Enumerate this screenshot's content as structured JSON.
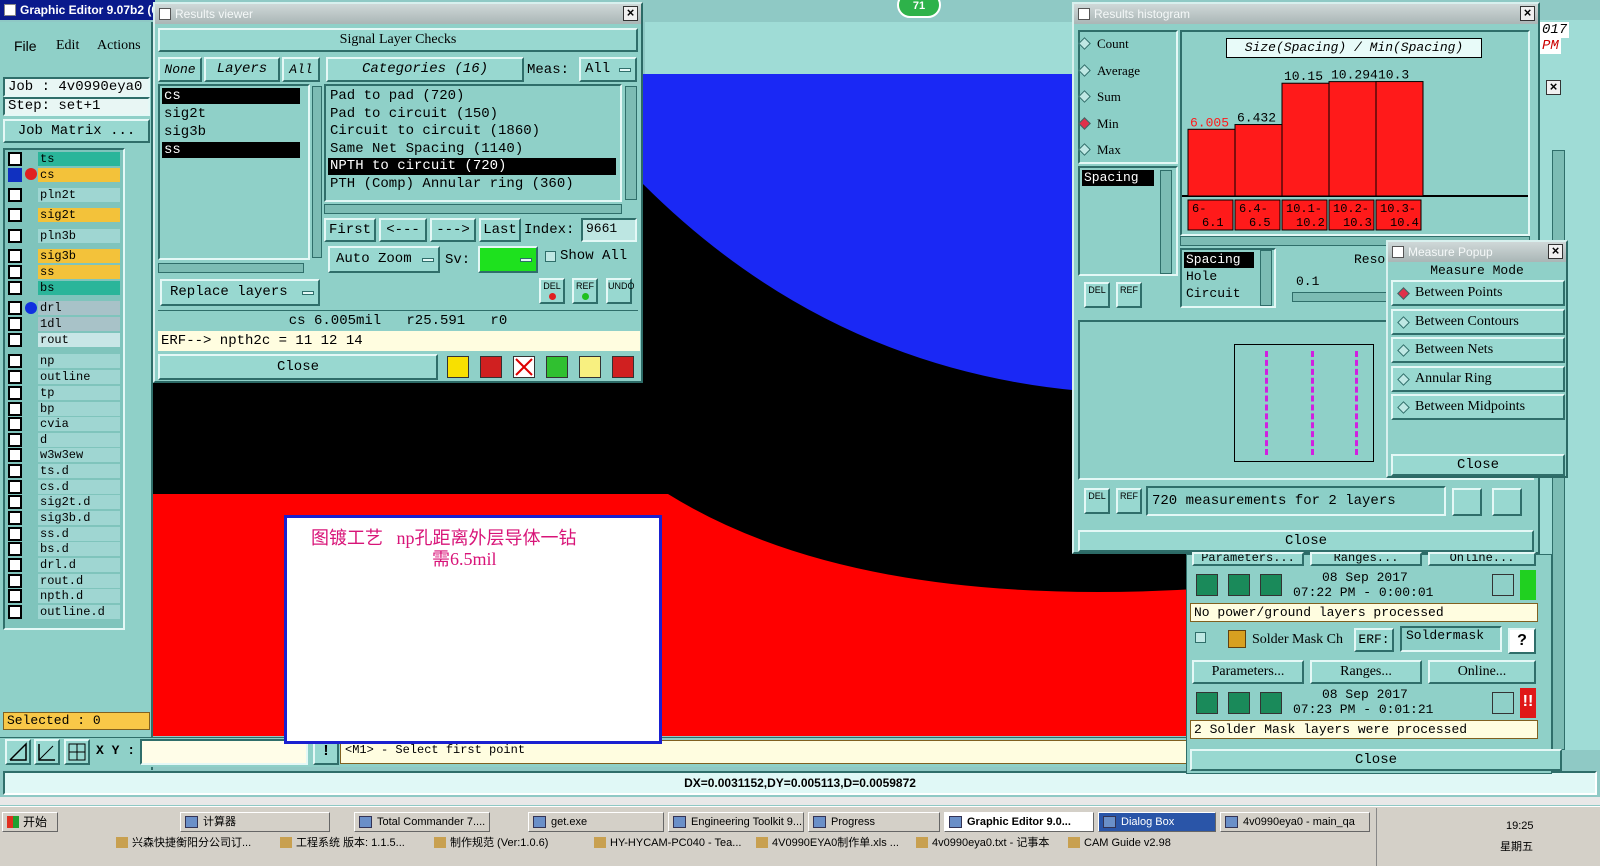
{
  "main": {
    "title": "Graphic Editor 9.07b2 (0",
    "menu": [
      "File",
      "Edit",
      "Actions"
    ],
    "job": "Job : 4v0990eya0",
    "step": "Step: set+1",
    "job_matrix": "Job Matrix ...",
    "layers": [
      {
        "name": "ts",
        "color": "#2ab59a"
      },
      {
        "name": "cs",
        "color": "#f3c23a"
      },
      {
        "name": "pln2t",
        "color": "#9fd6d2"
      },
      {
        "name": "sig2t",
        "color": "#f3c23a"
      },
      {
        "name": "pln3b",
        "color": "#9fd6d2"
      },
      {
        "name": "sig3b",
        "color": "#f3c23a"
      },
      {
        "name": "ss",
        "color": "#f3c23a"
      },
      {
        "name": "bs",
        "color": "#2ab59a"
      },
      {
        "name": "drl",
        "color": "#a8c2c8"
      },
      {
        "name": "1dl",
        "color": "#a8c2c8"
      },
      {
        "name": "rout",
        "color": "#c8e6e6"
      },
      {
        "name": "np",
        "color": "#9fd6d2"
      },
      {
        "name": "outline",
        "color": "#9fd6d2"
      },
      {
        "name": "tp",
        "color": "#9fd6d2"
      },
      {
        "name": "bp",
        "color": "#9fd6d2"
      },
      {
        "name": "cvia",
        "color": "#9fd6d2"
      },
      {
        "name": "d",
        "color": "#9fd6d2"
      },
      {
        "name": "w3w3ew",
        "color": "#9fd6d2"
      },
      {
        "name": "ts.d",
        "color": "#9fd6d2"
      },
      {
        "name": "cs.d",
        "color": "#9fd6d2"
      },
      {
        "name": "sig2t.d",
        "color": "#9fd6d2"
      },
      {
        "name": "sig3b.d",
        "color": "#9fd6d2"
      },
      {
        "name": "ss.d",
        "color": "#9fd6d2"
      },
      {
        "name": "bs.d",
        "color": "#9fd6d2"
      },
      {
        "name": "drl.d",
        "color": "#9fd6d2"
      },
      {
        "name": "rout.d",
        "color": "#9fd6d2"
      },
      {
        "name": "npth.d",
        "color": "#9fd6d2"
      },
      {
        "name": "outline.d",
        "color": "#9fd6d2"
      }
    ],
    "selected": "Selected : 0",
    "xy_label": "X Y :",
    "prompt": "<M1> - Select first point",
    "status": "DX=0.0031152,DY=0.005113,D=0.0059872",
    "badge": "71",
    "note_line1": "图镀工艺   np孔距离外层导体一钻",
    "note_line2": "需6.5mil"
  },
  "results_viewer": {
    "title": "Results viewer",
    "header": "Signal Layer Checks",
    "none": "None",
    "layers": "Layers",
    "all": "All",
    "categories": "Categories (16)",
    "meas_label": "Meas:",
    "meas_value": "All",
    "layer_list": [
      "cs",
      "sig2t",
      "sig3b",
      "ss"
    ],
    "category_list": [
      "Pad to pad (720)",
      "Pad to circuit (150)",
      "Circuit to circuit (1860)",
      "Same Net Spacing (1140)",
      "NPTH to circuit (720)",
      "PTH (Comp) Annular ring (360)"
    ],
    "first": "First",
    "prev": "<---",
    "next": "--->",
    "last": "Last",
    "index_label": "Index:",
    "index_value": "9661",
    "auto_zoom": "Auto Zoom",
    "sv": "Sv:",
    "show_all": "Show All",
    "replace_layers": "Replace layers",
    "del": "DEL",
    "ref": "REF",
    "undo": "UNDO",
    "measure_line": "cs 6.005mil   r25.591   r0",
    "erf_line": "ERF--> npth2c = 11 12 14",
    "close": "Close"
  },
  "histogram": {
    "title": "Results histogram",
    "radios": [
      "Count",
      "Average",
      "Sum",
      "Min",
      "Max"
    ],
    "selected_radio": "Min",
    "list1": [
      "Spacing"
    ],
    "chart_title": "Size(Spacing) / Min(Spacing)",
    "list2": [
      "Spacing",
      "Hole",
      "Circuit"
    ],
    "resolution_label": "Reso",
    "resolution_value": "0.1",
    "del": "DEL",
    "ref": "REF",
    "measurements": "720 measurements for 2 layers",
    "close": "Close"
  },
  "chart_data": {
    "type": "bar",
    "title": "Size(Spacing) / Min(Spacing)",
    "categories": [
      "6- 6.1",
      "6.4- 6.5",
      "10.1- 10.2",
      "10.2- 10.3",
      "10.3- 10.4"
    ],
    "values": [
      6.005,
      6.432,
      10.15,
      10.294,
      10.3
    ],
    "value_labels": [
      "6.005",
      "6.432",
      "10.15",
      "10.294",
      "10.3"
    ],
    "ylim": [
      0,
      10.8
    ]
  },
  "measure_popup": {
    "title": "Measure Popup",
    "mode_label": "Measure Mode",
    "options": [
      "Between Points",
      "Between Contours",
      "Between Nets",
      "Annular Ring",
      "Between Midpoints"
    ],
    "selected": "Between Points",
    "close": "Close"
  },
  "checklist": {
    "params_top": "Parameters...",
    "ranges_top": "Ranges...",
    "online_top": "Online...",
    "row1_date": "08 Sep 2017",
    "row1_time": "07:22 PM - 0:00:01",
    "row1_msg": "No power/ground layers processed",
    "row2_name": "Solder Mask Ch",
    "row2_erf": "ERF:",
    "row2_erf_value": "Soldermask",
    "row2_help": "?",
    "params": "Parameters...",
    "ranges": "Ranges...",
    "online": "Online...",
    "row2_date": "08 Sep 2017",
    "row2_time": "07:23 PM - 0:01:21",
    "row2_msg": "2 Solder Mask layers were processed",
    "close": "Close",
    "edge1": "017",
    "edge2": "PM"
  },
  "taskbar": {
    "start": "开始",
    "row1": [
      "计算器",
      "Total Commander 7....",
      "get.exe",
      "Engineering Toolkit 9...",
      "Progress",
      "Graphic Editor 9.0...",
      "Dialog Box",
      "4v0990eya0 - main_qa"
    ],
    "row2": [
      "兴森快捷衡阳分公司订...",
      "工程系统  版本: 1.1.5...",
      "制作规范 (Ver:1.0.6)",
      "HY-HYCAM-PC040 - Tea...",
      "4V0990EYA0制作单.xls ...",
      "4v0990eya0.txt - 记事本",
      "CAM Guide v2.98"
    ],
    "clock": "19:25",
    "day": "星期五"
  }
}
